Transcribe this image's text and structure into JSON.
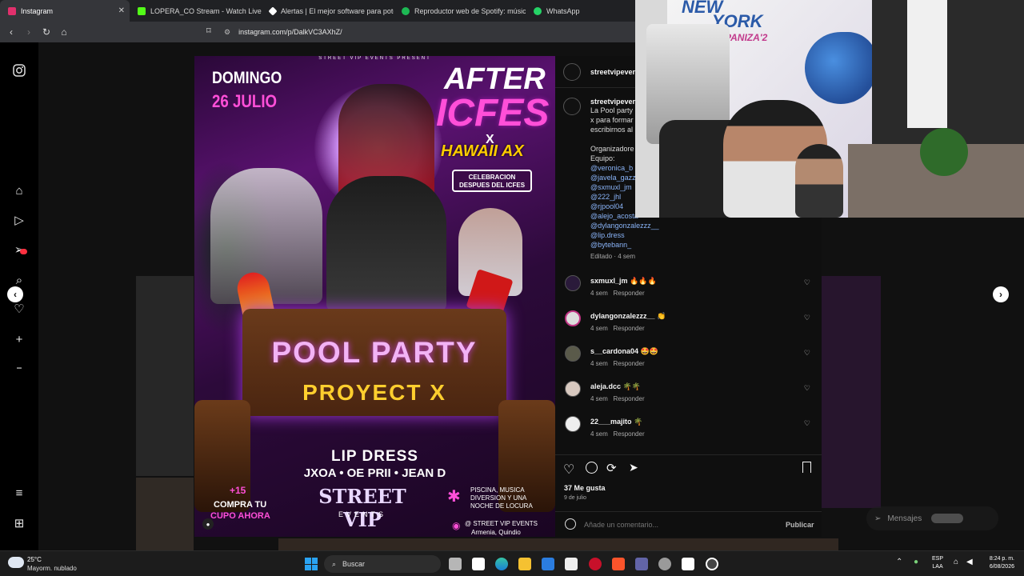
{
  "tabs": [
    {
      "label": "Instagram",
      "color": "#e1306c",
      "active": true,
      "close": "✕"
    },
    {
      "label": "LOPERA_CO Stream - Watch Live on",
      "color": "#53fc18"
    },
    {
      "label": "Alertas | El mejor software para poten",
      "color": "#ffffff"
    },
    {
      "label": "Reproductor web de Spotify: música",
      "color": "#1db954"
    },
    {
      "label": "WhatsApp",
      "color": "#25d366"
    }
  ],
  "address": {
    "url": "instagram.com/p/DalkVC3AXhZ/"
  },
  "poster": {
    "presenter": "STREET VIP EVENTS PRESENT",
    "day": "DOMINGO",
    "date": "26 JULIO",
    "title1": "AFTER",
    "title2": "ICFES",
    "x": "X",
    "title3": "HAWAII AX",
    "celebration": "CELEBRACION\nDESPUES DEL ICFES",
    "pool": "POOL PARTY",
    "project": "PROYECT X",
    "lineup1": "LIP DRESS",
    "lineup2": "JXOA • OE PRII • JEAN D",
    "age": "+15",
    "buy": "COMPRA TU",
    "buy2": "CUPO AHORA",
    "brand": "STREET VIP",
    "brand2": "EVENTS",
    "features": "PISCINA, MUSICA\nDIVERSION Y UNA\nNOCHE DE LOCURA",
    "location1": "@ STREET VIP EVENTS",
    "location2": "Armenia, Quindio"
  },
  "post": {
    "author": "streetvipevent",
    "caption_author": "streetvipeven",
    "caption_lines": [
      "La Pool party",
      "x para formar",
      "escribirnos al"
    ],
    "organizers": "Organizadore",
    "team": "Equipo:",
    "mentions": [
      "@veronica_b",
      "@javela_gazz",
      "@sxmuxl_jm",
      "@222_jhl",
      "@rjpool04",
      "@alejo_acosta",
      "@dylangonzalezzz__",
      "@lip.dress",
      "@bytebann_"
    ],
    "edited": "Editado · 4 sem",
    "comments": [
      {
        "user": "sxmuxl_jm",
        "text": "🔥🔥🔥",
        "time": "4 sem",
        "reply": "Responder"
      },
      {
        "user": "dylangonzalezzz__",
        "text": "👏",
        "time": "4 sem",
        "reply": "Responder"
      },
      {
        "user": "s__cardona04",
        "text": "🤩🤩",
        "time": "4 sem",
        "reply": "Responder"
      },
      {
        "user": "aleja.dcc",
        "text": "🌴🌴",
        "time": "4 sem",
        "reply": "Responder"
      },
      {
        "user": "22___majito",
        "text": "🌴",
        "time": "4 sem",
        "reply": "Responder"
      }
    ],
    "likes": "37 Me gusta",
    "date": "9 de julio",
    "comment_placeholder": "Añade un comentario...",
    "publish": "Publicar"
  },
  "messages": "Mensajes",
  "weather": {
    "temp": "25°C",
    "desc": "Mayorm. nublado"
  },
  "search": "Buscar",
  "tray": {
    "lang1": "ESP",
    "lang2": "LAA",
    "time": "8:24 p. m.",
    "date": "6/08/2026"
  }
}
